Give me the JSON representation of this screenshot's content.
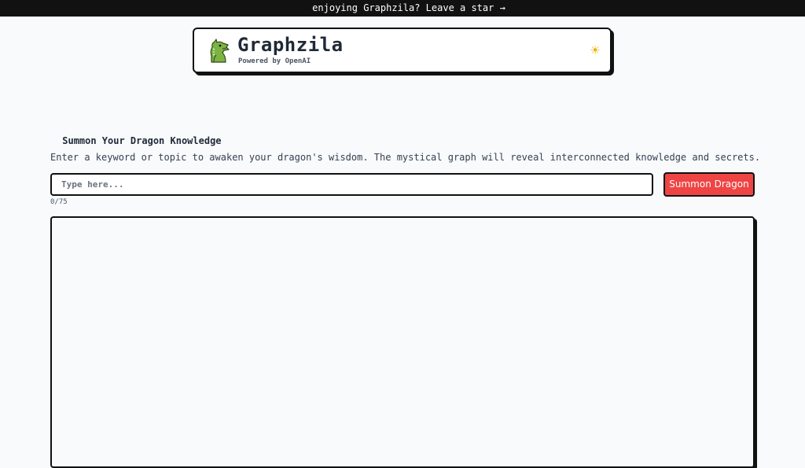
{
  "banner": {
    "icon": "star-icon",
    "glyph": "",
    "text": "enjoying Graphzila? Leave a star →"
  },
  "header": {
    "title": "Graphzila",
    "subtitle": "Powered by OpenAI",
    "logo_icon": "dragon-logo-icon",
    "theme_toggle_icon": "sun-icon",
    "theme_toggle_glyph": "☀"
  },
  "main": {
    "heading_glyph_left": "",
    "heading": "Summon Your Dragon Knowledge",
    "heading_glyph_right": "",
    "description": "Enter a keyword or topic to awaken your dragon's wisdom. The mystical graph will reveal interconnected knowledge and secrets.",
    "input": {
      "value": "",
      "placeholder": "Type here..."
    },
    "submit_label": "Summon Dragon ",
    "char_count": "0/75"
  },
  "colors": {
    "accent": "#ef4444",
    "border": "#111111",
    "background": "#f8fafc",
    "sun": "#eab308"
  }
}
